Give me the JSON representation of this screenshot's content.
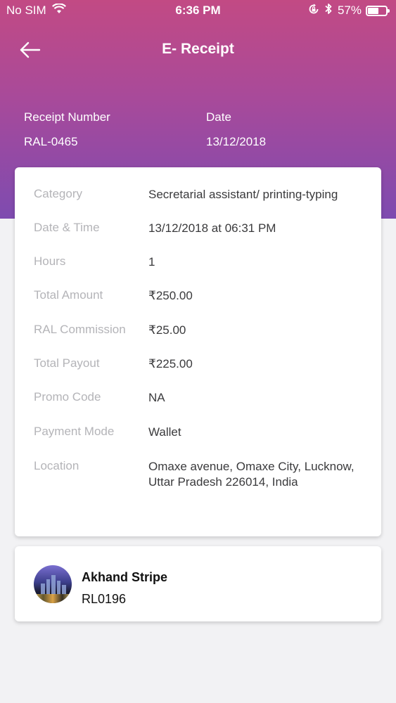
{
  "status_bar": {
    "carrier": "No SIM",
    "time": "6:36 PM",
    "battery": "57%",
    "battery_level": 0.57,
    "icons": [
      "wifi-icon",
      "rotation-lock-icon",
      "bluetooth-icon",
      "battery-icon"
    ]
  },
  "nav": {
    "title": "E- Receipt",
    "back_icon": "back-arrow-icon"
  },
  "receipt": {
    "number_label": "Receipt Number",
    "number": "RAL-0465",
    "date_label": "Date",
    "date": "13/12/2018"
  },
  "details": [
    {
      "label": "Category",
      "value": "Secretarial assistant/ printing-typing"
    },
    {
      "label": "Date & Time",
      "value": "13/12/2018 at 06:31 PM"
    },
    {
      "label": "Hours",
      "value": "1"
    },
    {
      "label": "Total Amount",
      "value": "₹250.00"
    },
    {
      "label": "RAL Commission",
      "value": "₹25.00"
    },
    {
      "label": "Total Payout",
      "value": "₹225.00"
    },
    {
      "label": "Promo Code",
      "value": "NA"
    },
    {
      "label": "Payment Mode",
      "value": "Wallet"
    },
    {
      "label": "Location",
      "value": "Omaxe avenue, Omaxe City, Lucknow, Uttar Pradesh 226014, India"
    }
  ],
  "worker": {
    "name": "Akhand Stripe",
    "id": "RL0196"
  },
  "colors": {
    "gradient_top": "#c24a84",
    "gradient_bottom": "#7e4bb0",
    "label_gray": "#b4b4b8",
    "value_dark": "#3a3a3c",
    "background": "#f2f2f4"
  }
}
